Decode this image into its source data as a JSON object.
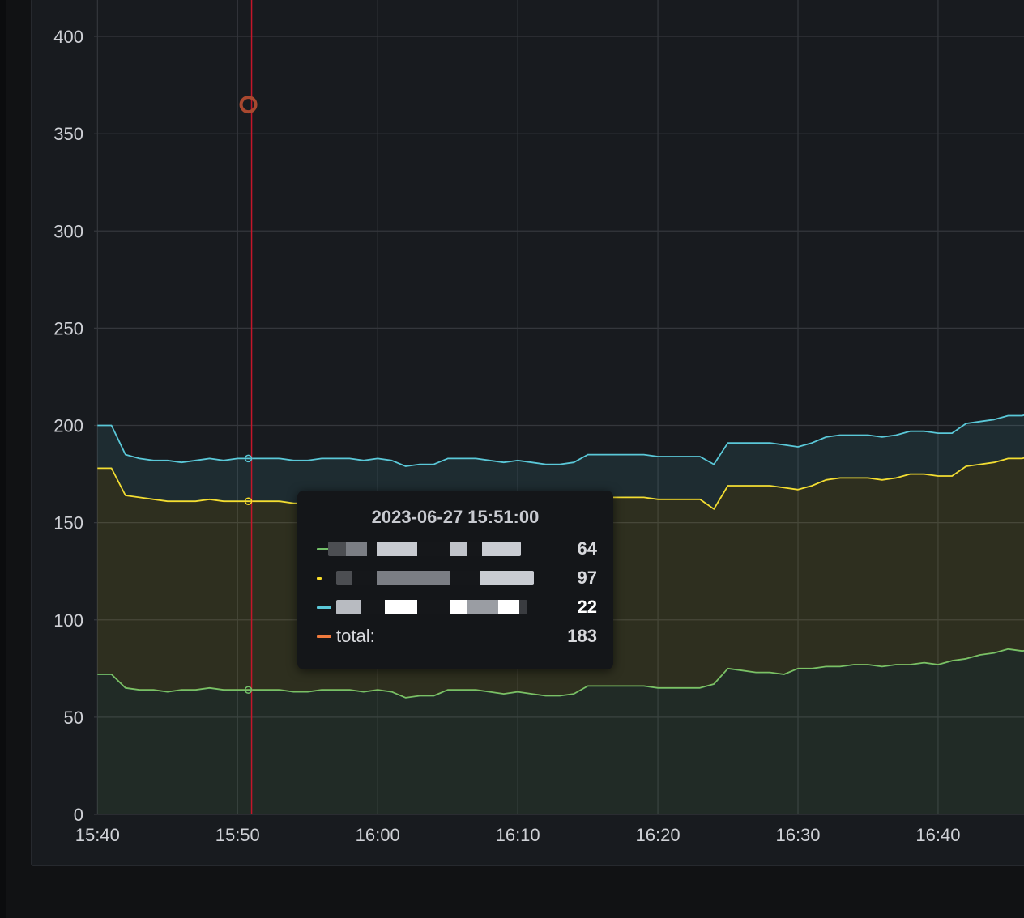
{
  "chart_data": {
    "type": "area",
    "title": "",
    "xlabel": "",
    "ylabel": "",
    "stacked": true,
    "ylim": [
      0,
      420
    ],
    "xlim": [
      "15:39:45",
      "16:47:00"
    ],
    "y_ticks": [
      0,
      50,
      100,
      150,
      200,
      250,
      300,
      350,
      400
    ],
    "x_tick_labels": [
      "15:40",
      "15:50",
      "16:00",
      "16:10",
      "16:20",
      "16:30",
      "16:40"
    ],
    "grid": true,
    "legend": "none",
    "x": [
      "15:40",
      "15:41",
      "15:42",
      "15:43",
      "15:44",
      "15:45",
      "15:46",
      "15:47",
      "15:48",
      "15:49",
      "15:50",
      "15:51",
      "15:52",
      "15:53",
      "15:54",
      "15:55",
      "15:56",
      "15:57",
      "15:58",
      "15:59",
      "16:00",
      "16:01",
      "16:02",
      "16:03",
      "16:04",
      "16:05",
      "16:06",
      "16:07",
      "16:08",
      "16:09",
      "16:10",
      "16:11",
      "16:12",
      "16:13",
      "16:14",
      "16:15",
      "16:16",
      "16:17",
      "16:18",
      "16:19",
      "16:20",
      "16:21",
      "16:22",
      "16:23",
      "16:24",
      "16:25",
      "16:26",
      "16:27",
      "16:28",
      "16:29",
      "16:30",
      "16:31",
      "16:32",
      "16:33",
      "16:34",
      "16:35",
      "16:36",
      "16:37",
      "16:38",
      "16:39",
      "16:40",
      "16:41",
      "16:42",
      "16:43",
      "16:44",
      "16:45",
      "16:46",
      "16:47"
    ],
    "series": [
      {
        "name": "",
        "color": "#73bf69",
        "values": [
          72,
          72,
          65,
          64,
          64,
          63,
          64,
          64,
          65,
          64,
          64,
          64,
          64,
          64,
          63,
          63,
          64,
          64,
          64,
          63,
          64,
          63,
          60,
          61,
          61,
          64,
          64,
          64,
          63,
          62,
          63,
          62,
          61,
          61,
          62,
          66,
          66,
          66,
          66,
          66,
          65,
          65,
          65,
          65,
          67,
          75,
          74,
          73,
          73,
          72,
          75,
          75,
          76,
          76,
          77,
          77,
          76,
          77,
          77,
          78,
          77,
          79,
          80,
          82,
          83,
          85,
          84,
          85
        ]
      },
      {
        "name": "",
        "color": "#fade2a",
        "values": [
          106,
          106,
          99,
          99,
          98,
          98,
          97,
          97,
          97,
          97,
          97,
          97,
          97,
          97,
          97,
          97,
          97,
          97,
          97,
          97,
          97,
          97,
          97,
          97,
          97,
          97,
          97,
          97,
          97,
          97,
          97,
          97,
          97,
          97,
          97,
          97,
          97,
          97,
          97,
          97,
          97,
          97,
          97,
          97,
          90,
          94,
          95,
          96,
          96,
          96,
          92,
          94,
          96,
          97,
          96,
          96,
          96,
          96,
          98,
          97,
          97,
          95,
          99,
          98,
          98,
          98,
          99,
          100
        ]
      },
      {
        "name": "",
        "color": "#5ac8d8",
        "values": [
          22,
          22,
          21,
          20,
          20,
          21,
          20,
          21,
          21,
          21,
          22,
          22,
          22,
          22,
          22,
          22,
          22,
          22,
          22,
          22,
          22,
          22,
          22,
          22,
          22,
          22,
          22,
          22,
          22,
          22,
          22,
          22,
          22,
          22,
          22,
          22,
          22,
          22,
          22,
          22,
          22,
          22,
          22,
          22,
          23,
          22,
          22,
          22,
          22,
          22,
          22,
          22,
          22,
          22,
          22,
          22,
          22,
          22,
          22,
          22,
          22,
          22,
          22,
          22,
          22,
          22,
          22,
          22
        ]
      }
    ],
    "cursor": {
      "x": "15:51",
      "series_values": [
        64,
        161,
        183
      ]
    },
    "annotation_marker_y": 365,
    "tooltip": {
      "title": "2023-06-27 15:51:00",
      "rows": [
        {
          "label": "",
          "value": "64",
          "color": "#73bf69"
        },
        {
          "label": "",
          "value": "97",
          "color": "#fade2a"
        },
        {
          "label": "",
          "value": "22",
          "color": "#5ac8d8"
        },
        {
          "label": "total:",
          "value": "183",
          "color": "#f07a3d"
        }
      ]
    }
  }
}
